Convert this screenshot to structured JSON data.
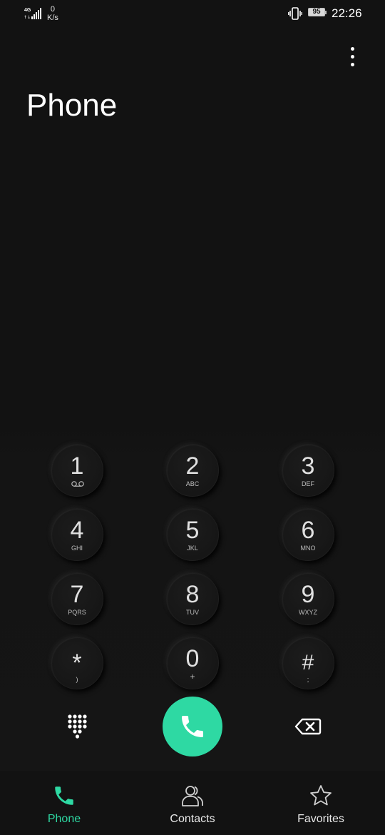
{
  "status_bar": {
    "network_type": "4G",
    "speed_value": "0",
    "speed_unit": "K/s",
    "battery_level": "95",
    "time": "22:26"
  },
  "header": {
    "title": "Phone",
    "menu_icon": "more-vert-icon"
  },
  "dialpad": {
    "keys": [
      {
        "digit": "1",
        "letters": "",
        "sub_icon": "voicemail-icon"
      },
      {
        "digit": "2",
        "letters": "ABC"
      },
      {
        "digit": "3",
        "letters": "DEF"
      },
      {
        "digit": "4",
        "letters": "GHI"
      },
      {
        "digit": "5",
        "letters": "JKL"
      },
      {
        "digit": "6",
        "letters": "MNO"
      },
      {
        "digit": "7",
        "letters": "PQRS"
      },
      {
        "digit": "8",
        "letters": "TUV"
      },
      {
        "digit": "9",
        "letters": "WXYZ"
      },
      {
        "digit": "*",
        "letters": ")"
      },
      {
        "digit": "0",
        "letters": "+"
      },
      {
        "digit": "#",
        "letters": ";"
      }
    ]
  },
  "actions": {
    "dialpad_toggle_icon": "dialpad-icon",
    "call_icon": "phone-icon",
    "backspace_icon": "backspace-icon"
  },
  "bottom_nav": {
    "items": [
      {
        "label": "Phone",
        "icon": "phone-icon",
        "active": true
      },
      {
        "label": "Contacts",
        "icon": "contacts-icon",
        "active": false
      },
      {
        "label": "Favorites",
        "icon": "star-icon",
        "active": false
      }
    ]
  },
  "colors": {
    "background": "#121212",
    "accent": "#2ED9A3",
    "text_primary": "#FFFFFF",
    "key_digit": "#E0E0E0"
  }
}
